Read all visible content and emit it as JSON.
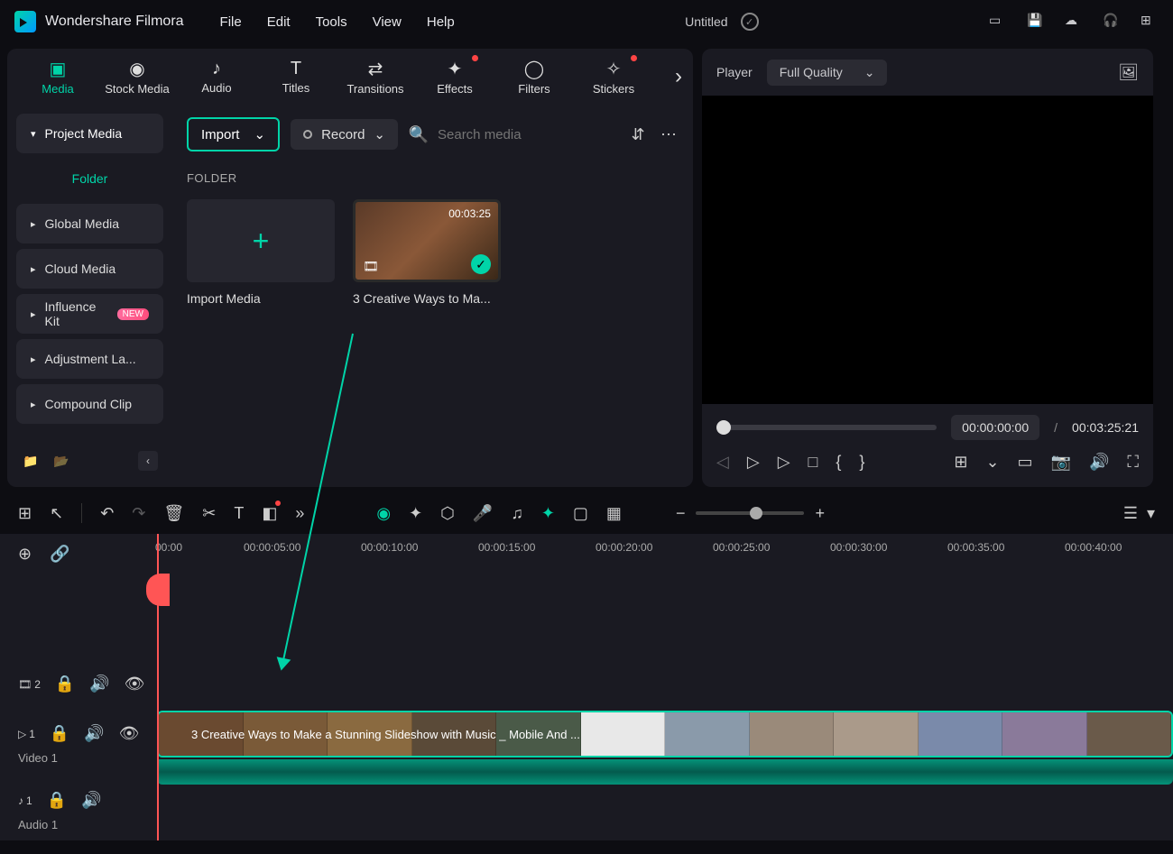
{
  "app_name": "Wondershare Filmora",
  "menu": [
    "File",
    "Edit",
    "Tools",
    "View",
    "Help"
  ],
  "doc_title": "Untitled",
  "tabs": [
    {
      "label": "Media",
      "active": true
    },
    {
      "label": "Stock Media"
    },
    {
      "label": "Audio"
    },
    {
      "label": "Titles"
    },
    {
      "label": "Transitions"
    },
    {
      "label": "Effects",
      "dot": true
    },
    {
      "label": "Filters"
    },
    {
      "label": "Stickers",
      "dot": true
    }
  ],
  "sidebar": {
    "project_media": "Project Media",
    "folder": "Folder",
    "items": [
      {
        "label": "Global Media"
      },
      {
        "label": "Cloud Media"
      },
      {
        "label": "Influence Kit",
        "new": true
      },
      {
        "label": "Adjustment La..."
      },
      {
        "label": "Compound Clip"
      }
    ]
  },
  "content": {
    "import_label": "Import",
    "record_label": "Record",
    "search_placeholder": "Search media",
    "folder_heading": "FOLDER",
    "import_media_label": "Import Media",
    "clip_duration": "00:03:25",
    "clip_name": "3 Creative Ways to Ma..."
  },
  "player": {
    "label": "Player",
    "quality": "Full Quality",
    "current_time": "00:00:00:00",
    "total_time": "00:03:25:21"
  },
  "ruler": [
    "00:00",
    "00:00:05:00",
    "00:00:10:00",
    "00:00:15:00",
    "00:00:20:00",
    "00:00:25:00",
    "00:00:30:00",
    "00:00:35:00",
    "00:00:40:00"
  ],
  "timeline": {
    "clip_title": "3 Creative Ways to Make a Stunning Slideshow with Music _ Mobile And ...",
    "track2_num": "2",
    "track1_num": "1",
    "video1_label": "Video 1",
    "audio1_num": "1",
    "audio1_label": "Audio 1"
  },
  "new_badge_text": "NEW"
}
